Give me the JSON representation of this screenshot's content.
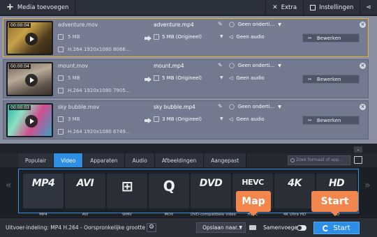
{
  "toolbar": {
    "add_media": "Media toevoegen",
    "extra": "Extra",
    "settings": "Instellingen"
  },
  "files": [
    {
      "duration": "00:00:04",
      "source_name": "adventure.mov",
      "source_size": "5 MB",
      "source_info": "H.264 1920x1080 8066...",
      "output_name": "adventure.mp4",
      "output_size": "5 MB (Origineel)",
      "subtitles": "Geen onderti...",
      "audio": "Geen audio",
      "edit_label": "Bewerken",
      "selected": true
    },
    {
      "duration": "00:00:04",
      "source_name": "mount.mov",
      "source_size": "5 MB",
      "source_info": "H.264 1920x1080 7905...",
      "output_name": "mount.mp4",
      "output_size": "5 MB (Origineel)",
      "subtitles": "Geen onderti...",
      "audio": "Geen audio",
      "edit_label": "Bewerken",
      "selected": false
    },
    {
      "duration": "00:00:03",
      "source_name": "sky bubble.mov",
      "source_size": "3 MB",
      "source_info": "H.264 1920x1080 6749...",
      "output_name": "sky bubble.mp4",
      "output_size": "3 MB (Origineel)",
      "subtitles": "Geen onderti...",
      "audio": "Geen audio",
      "edit_label": "Bewerken",
      "selected": false
    }
  ],
  "tabs": [
    {
      "label": "Populair",
      "active": false
    },
    {
      "label": "Video",
      "active": true
    },
    {
      "label": "Apparaten",
      "active": false
    },
    {
      "label": "Audio",
      "active": false
    },
    {
      "label": "Afbeeldingen",
      "active": false
    },
    {
      "label": "Aangepast",
      "active": false
    }
  ],
  "search_placeholder": "Zoek formaat of app...",
  "formats": [
    {
      "logo": "MP4",
      "label": "MP4",
      "selected": true
    },
    {
      "logo": "AVI",
      "label": "AVI",
      "selected": false
    },
    {
      "logo": "⊞",
      "label": "WMV",
      "selected": false
    },
    {
      "logo": "Q",
      "label": "MOV",
      "selected": false
    },
    {
      "logo": "DVD",
      "label": "DVD-compatibele video",
      "selected": false
    },
    {
      "logo": "HEVC",
      "label": "HEVC",
      "selected": false
    },
    {
      "logo": "4K",
      "label": "4K Ultra HD",
      "selected": false
    },
    {
      "logo": "HD",
      "label": "HD",
      "selected": false
    }
  ],
  "bottom": {
    "output_format": "Uitvoer-indeling: MP4 H.264 - Oorspronkelijke grootte",
    "save_to": "Opslaan naar...",
    "merge": "Samenvoegen",
    "start": "Start"
  },
  "callouts": {
    "map": "Map",
    "start": "Start"
  },
  "colors": {
    "accent": "#2d8ee8",
    "callout": "#f3864c",
    "selected_row_border": "#e8b531"
  }
}
